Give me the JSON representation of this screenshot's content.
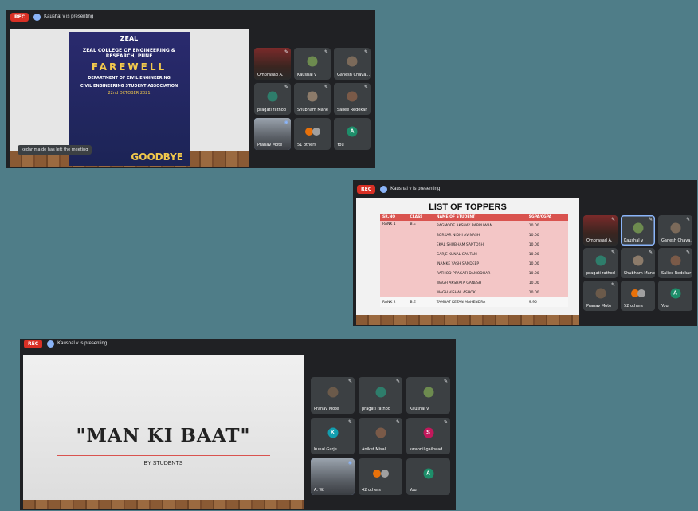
{
  "shot1": {
    "rec": "REC",
    "presenter": "Kaushal v is presenting",
    "toast": "kedar malde has left the meeting",
    "poster": {
      "logo": "ZEAL",
      "college": "ZEAL COLLEGE OF ENGINEERING & RESEARCH, PUNE",
      "title": "FAREWELL",
      "dept": "DEPARTMENT OF CIVIL ENGINEERING",
      "assoc": "CIVIL ENGINEERING STUDENT ASSOCIATION",
      "date": "22nd OCTOBER 2021",
      "bye": "GOODBYE"
    },
    "tiles": [
      {
        "name": "Omprasad A.",
        "type": "video"
      },
      {
        "name": "Kaushal v",
        "type": "avatar",
        "color": "#6d8b4f"
      },
      {
        "name": "Ganesh Chava...",
        "type": "avatar",
        "color": "#7b6a5a"
      },
      {
        "name": "pragati rathod",
        "type": "avatar",
        "color": "#2e7d6b"
      },
      {
        "name": "Shubham Mane",
        "type": "avatar",
        "color": "#8c7b6a"
      },
      {
        "name": "Saliee Redekar",
        "type": "avatar",
        "color": "#7a5a48"
      },
      {
        "name": "Pranav Mote",
        "type": "video-active"
      },
      {
        "name": "51 others",
        "type": "others"
      },
      {
        "name": "You",
        "type": "letter",
        "letter": "A",
        "color": "#1e8e6a"
      }
    ]
  },
  "shot2": {
    "rec": "REC",
    "presenter": "Kaushal v is presenting",
    "table_title": "LIST OF TOPPERS",
    "headers": [
      "SR.NO",
      "CLASS",
      "NAME OF STUDENT",
      "SGPA/CGPA"
    ],
    "rank1": {
      "rank": "RANK 1",
      "class": "B.E",
      "students": [
        [
          "BAGMODE AKSHAY BABRUWAN",
          "10.00"
        ],
        [
          "BORKAR NIDHI AVINASH",
          "10.00"
        ],
        [
          "EKAL SHUBHAM SANTOSH",
          "10.00"
        ],
        [
          "GARJE KUNAL GAUTAM",
          "10.00"
        ],
        [
          "INAMKE YASH SANDEEP",
          "10.00"
        ],
        [
          "RATHOD PRAGATI DAMODHAR",
          "10.00"
        ],
        [
          "WAGH AKSHATA GANESH",
          "10.00"
        ],
        [
          "WAGH VISHAL ASHOK",
          "10.00"
        ]
      ]
    },
    "rank2": {
      "rank": "RANK 2",
      "class": "B.E",
      "name": "TAMBAT KETAN MAHENDRA",
      "score": "9.95"
    },
    "tiles": [
      {
        "name": "Omprasad A.",
        "type": "video"
      },
      {
        "name": "Kaushal v",
        "type": "avatar-active",
        "color": "#6d8b4f"
      },
      {
        "name": "Ganesh Chava...",
        "type": "avatar",
        "color": "#7b6a5a"
      },
      {
        "name": "pragati rathod",
        "type": "avatar",
        "color": "#2e7d6b"
      },
      {
        "name": "Shubham Mane",
        "type": "avatar",
        "color": "#8c7b6a"
      },
      {
        "name": "Saliee Redekar",
        "type": "avatar",
        "color": "#7a5a48"
      },
      {
        "name": "Pranav Mote",
        "type": "avatar",
        "color": "#6b5a4a"
      },
      {
        "name": "52 others",
        "type": "others"
      },
      {
        "name": "You",
        "type": "letter",
        "letter": "A",
        "color": "#1e8e6a"
      }
    ]
  },
  "shot3": {
    "rec": "REC",
    "presenter": "Kaushal v is presenting",
    "slide_title": "\"MAN KI BAAT\"",
    "slide_sub": "BY STUDENTS",
    "tiles": [
      {
        "name": "Pranav Mote",
        "type": "avatar",
        "color": "#6b5a4a"
      },
      {
        "name": "pragati rathod",
        "type": "avatar",
        "color": "#2e7d6b"
      },
      {
        "name": "Kaushal v",
        "type": "avatar",
        "color": "#6d8b4f"
      },
      {
        "name": "Kunal Garje",
        "type": "letter",
        "letter": "K",
        "color": "#129eaf"
      },
      {
        "name": "Aniket Misal",
        "type": "avatar",
        "color": "#7a5a48"
      },
      {
        "name": "swapnil gaikwad",
        "type": "letter",
        "letter": "S",
        "color": "#c2185b"
      },
      {
        "name": "A. W.",
        "type": "video-active"
      },
      {
        "name": "42 others",
        "type": "others"
      },
      {
        "name": "You",
        "type": "letter",
        "letter": "A",
        "color": "#1e8e6a"
      }
    ]
  }
}
